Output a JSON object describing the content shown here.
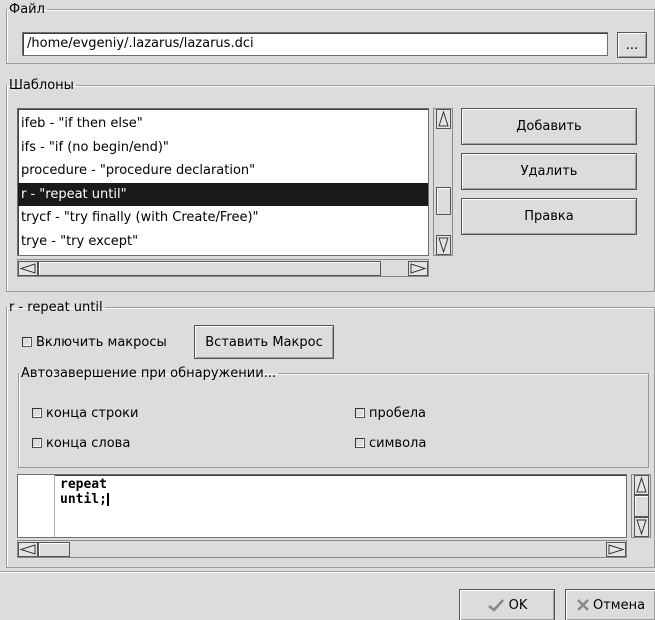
{
  "file_group": {
    "legend": "Файл",
    "path_value": "/home/evgeniy/.lazarus/lazarus.dci",
    "browse_label": "..."
  },
  "templates_group": {
    "legend": "Шаблоны",
    "items": [
      "ifeb - \"if then else\"",
      "ifs - \"if (no begin/end)\"",
      "procedure - \"procedure declaration\"",
      "r - \"repeat until\"",
      "trycf - \"try finally (with Create/Free)\"",
      "trye - \"try except\""
    ],
    "selected_index": 3,
    "add_label": "Добавить",
    "delete_label": "Удалить",
    "edit_label": "Правка"
  },
  "editor_group": {
    "legend": "r - repeat until",
    "enable_macros_label": "Включить макросы",
    "insert_macro_label": "Вставить Макрос",
    "autocomplete": {
      "legend": "Автозавершение при обнаружении...",
      "line_end_label": "конца строки",
      "word_end_label": "конца слова",
      "space_label": "пробела",
      "symbol_label": "символа"
    },
    "code_lines": [
      "repeat",
      "until;"
    ]
  },
  "footer": {
    "ok_label": "OK",
    "cancel_label": "Отмена"
  }
}
